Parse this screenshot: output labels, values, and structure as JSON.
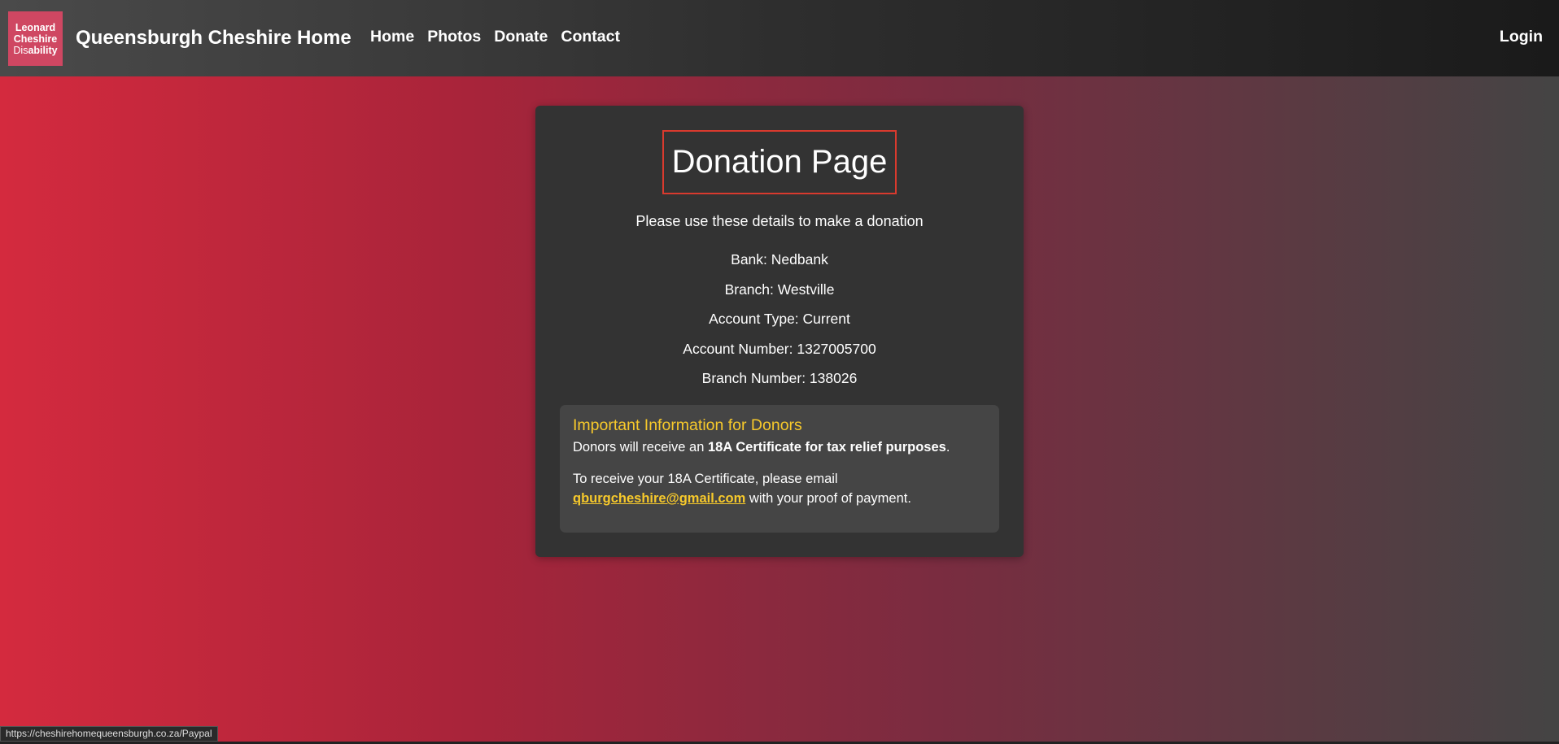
{
  "logo": {
    "line1": "Leonard",
    "line2": "Cheshire",
    "line3_a": "Dis",
    "line3_b": "ability"
  },
  "brand": "Queensburgh Cheshire Home",
  "nav": {
    "items": [
      "Home",
      "Photos",
      "Donate",
      "Contact"
    ],
    "login": "Login"
  },
  "card": {
    "title": "Donation Page",
    "intro": "Please use these details to make a donation",
    "details": [
      "Bank: Nedbank",
      "Branch: Westville",
      "Account Type: Current",
      "Account Number: 1327005700",
      "Branch Number: 138026"
    ],
    "info": {
      "heading": "Important Information for Donors",
      "p1_prefix": "Donors will receive an ",
      "p1_bold": "18A Certificate for tax relief purposes",
      "p1_suffix": ".",
      "p2_prefix": "To receive your 18A Certificate, please email",
      "email": "qburgcheshire@gmail.com",
      "p2_suffix": " with your proof of payment."
    }
  },
  "status_url": "https://cheshirehomequeensburgh.co.za/Paypal",
  "colors": {
    "accent": "#f7c92b",
    "title_border": "#d93a2e",
    "logo_bg": "#cf4762"
  }
}
